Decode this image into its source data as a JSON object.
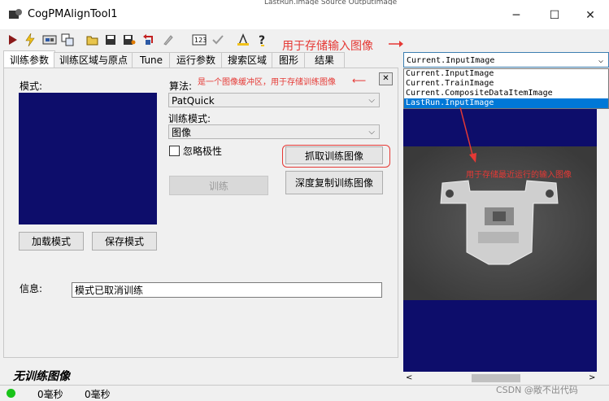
{
  "window": {
    "title": "CogPMAlignTool1",
    "bg_strip_text": "LastRun.Image Source  OutputImage"
  },
  "window_controls": {
    "minimize": "─",
    "maximize": "☐",
    "close": "✕"
  },
  "toolbar": {
    "icons": [
      "run-icon",
      "lightning-icon",
      "image-switch-icon",
      "copy-icon",
      "open-icon",
      "save-icon",
      "save-as-icon",
      "reset-icon",
      "edit-icon",
      "numeric-icon",
      "check-icon",
      "graphic-icon",
      "help-icon"
    ],
    "annotation": "用于存储输入图像"
  },
  "tabs": [
    {
      "label": "训练参数",
      "active": true
    },
    {
      "label": "训练区域与原点",
      "active": false
    },
    {
      "label": "Tune",
      "active": false
    },
    {
      "label": "运行参数",
      "active": false
    },
    {
      "label": "搜索区域",
      "active": false
    },
    {
      "label": "图形",
      "active": false
    },
    {
      "label": "结果",
      "active": false
    }
  ],
  "train": {
    "model_label": "模式:",
    "algorithm_label": "算法:",
    "algorithm_value": "PatQuick",
    "train_mode_label": "训练模式:",
    "train_mode_value": "图像",
    "ignore_polarity_label": "忽略极性",
    "grab_button": "抓取训练图像",
    "deep_copy_button": "深度复制训练图像",
    "train_button": "训练",
    "load_button": "加载模式",
    "save_button": "保存模式",
    "info_label": "信息:",
    "info_value": "模式已取消训练",
    "buffer_annotation": "是一个图像缓冲区，用于存储训练图像",
    "arrow_left": "⟵",
    "collapse": "✕"
  },
  "no_train_image": "无训练图像",
  "status": {
    "time1": "0毫秒",
    "time2": "0毫秒",
    "status_color": "#19c319"
  },
  "image_select": {
    "selected": "Current.InputImage",
    "options": [
      {
        "label": "Current.InputImage",
        "selected": false
      },
      {
        "label": "Current.TrainImage",
        "selected": false
      },
      {
        "label": "Current.CompositeDataItemImage",
        "selected": false
      },
      {
        "label": "LastRun.InputImage",
        "selected": true
      }
    ]
  },
  "display_annotation": "用于存储最近运行的输入图像",
  "watermark": "CSDN @敞不出代码",
  "colors": {
    "accent_red": "#e53935",
    "display_bg": "#0d0d6b",
    "selection_blue": "#0078d7"
  }
}
